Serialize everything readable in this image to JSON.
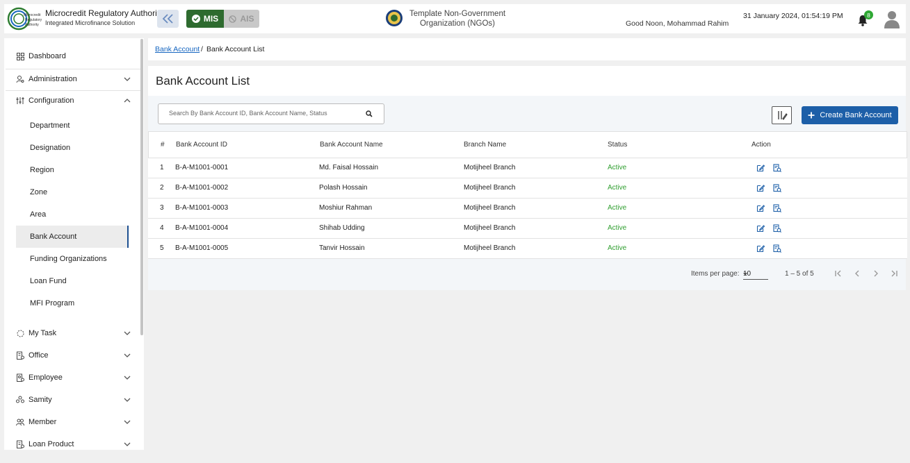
{
  "header": {
    "logo_text": "Microcredit Regulatory Authority",
    "title": "Microcredit Regulatory Authority",
    "subtitle": "Integrated Microfinance Solution",
    "module_mis": "MIS",
    "module_ais": "AIS",
    "org_name": "Template Non-Government Organization (NGOs)",
    "greeting": "Good Noon, Mohammad Rahim",
    "datetime": "31 January 2024, 01:54:19 PM",
    "notification_count": "8",
    "colors": {
      "mis_active": "#2e6b2f",
      "primary": "#1d5fa8",
      "status_active": "#2f9e2f"
    }
  },
  "sidebar": {
    "dashboard": "Dashboard",
    "administration": "Administration",
    "configuration": "Configuration",
    "config_items": [
      "Department",
      "Designation",
      "Region",
      "Zone",
      "Area",
      "Bank Account",
      "Funding Organizations",
      "Loan Fund",
      "MFI Program"
    ],
    "active_item": "Bank Account",
    "groups": [
      "My Task",
      "Office",
      "Employee",
      "Samity",
      "Member",
      "Loan Product"
    ]
  },
  "breadcrumb": {
    "parent": "Bank Account",
    "separator": "/",
    "current": "Bank Account List"
  },
  "main": {
    "title": "Bank Account List",
    "search_placeholder": "Search By Bank Account ID, Bank Account Name, Status",
    "create_label": "Create Bank Account"
  },
  "table": {
    "columns": [
      "#",
      "Bank Account ID",
      "Bank Account Name",
      "Branch Name",
      "Status",
      "Action"
    ],
    "rows": [
      {
        "num": "1",
        "id": "B-A-M1001-0001",
        "name": "Md. Faisal Hossain",
        "branch": "Motijheel Branch",
        "status": "Active"
      },
      {
        "num": "2",
        "id": "B-A-M1001-0002",
        "name": "Polash Hossain",
        "branch": "Motijheel Branch",
        "status": "Active"
      },
      {
        "num": "3",
        "id": "B-A-M1001-0003",
        "name": "Moshiur Rahman",
        "branch": "Motijheel Branch",
        "status": "Active"
      },
      {
        "num": "4",
        "id": "B-A-M1001-0004",
        "name": "Shihab Udding",
        "branch": "Motijheel Branch",
        "status": "Active"
      },
      {
        "num": "5",
        "id": "B-A-M1001-0005",
        "name": "Tanvir Hossain",
        "branch": "Motijheel Branch",
        "status": "Active"
      }
    ]
  },
  "pagination": {
    "items_per_page_label": "Items per page:",
    "items_per_page": "10",
    "range": "1 – 5 of 5"
  }
}
